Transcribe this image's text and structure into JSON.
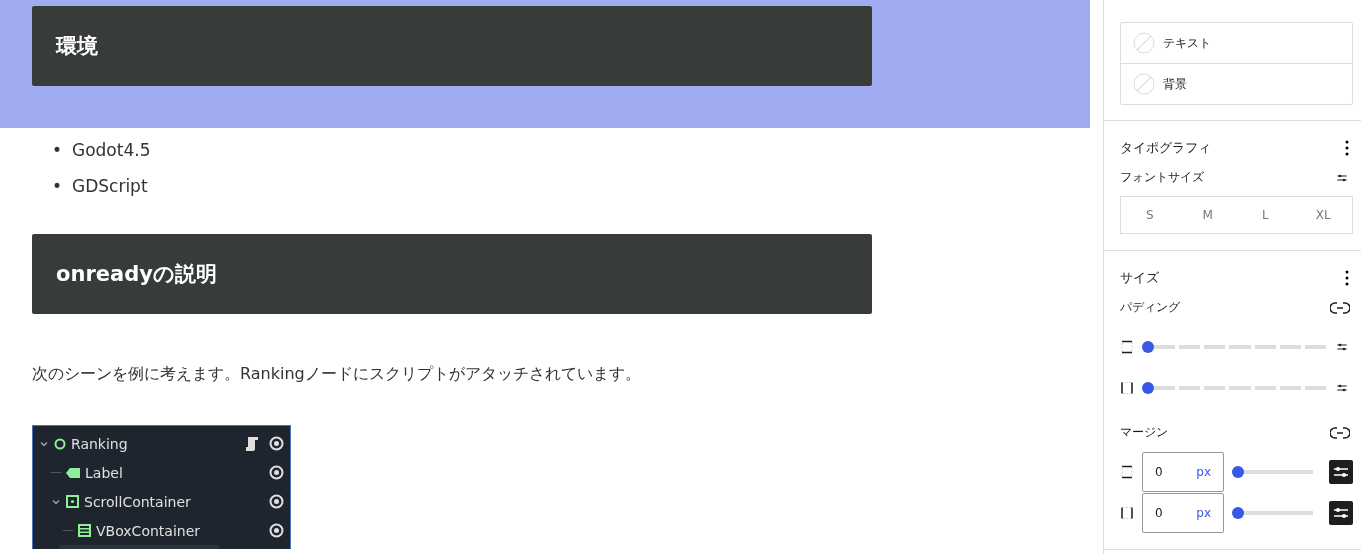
{
  "document": {
    "blocks": [
      {
        "kind": "heading",
        "text": "環境",
        "selected": true
      },
      {
        "kind": "list",
        "items": [
          {
            "marker": "•",
            "text": "Godot4.5"
          },
          {
            "marker": "•",
            "text": "GDScript"
          }
        ],
        "selected": false
      },
      {
        "kind": "heading",
        "text": "onreadyの説明",
        "selected": false
      },
      {
        "kind": "paragraph",
        "text": "次のシーンを例に考えます。Rankingノードにスクリプトがアタッチされています。",
        "selected": false
      },
      {
        "kind": "scene_tree",
        "selected": false,
        "nodes": [
          {
            "name": "Ranking",
            "kind": "node",
            "expanded": true,
            "has_script": true,
            "children": [
              {
                "name": "Label",
                "kind": "label",
                "has_script": false
              },
              {
                "name": "ScrollContainer",
                "kind": "scroll",
                "expanded": true,
                "has_script": false,
                "children": [
                  {
                    "name": "VBoxContainer",
                    "kind": "vbox",
                    "has_script": false
                  }
                ]
              }
            ]
          }
        ]
      }
    ]
  },
  "sidebar": {
    "colors": [
      {
        "label": "テキスト"
      },
      {
        "label": "背景"
      }
    ],
    "typography": {
      "title": "タイポグラフィ",
      "font_size_label": "フォントサイズ",
      "sizes": [
        {
          "label": "S",
          "selected": false
        },
        {
          "label": "M",
          "selected": false
        },
        {
          "label": "L",
          "selected": false
        },
        {
          "label": "XL",
          "selected": false
        }
      ]
    },
    "size": {
      "title": "サイズ",
      "padding": {
        "label": "パディング",
        "rows": [
          {
            "kind": "vertical",
            "level": 0
          },
          {
            "kind": "horizontal",
            "level": 0
          }
        ]
      },
      "margin": {
        "label": "マージン",
        "rows": [
          {
            "kind": "vertical",
            "value": "0",
            "unit": "px",
            "level": 0
          },
          {
            "kind": "horizontal",
            "value": "0",
            "unit": "px",
            "level": 0
          }
        ]
      }
    }
  }
}
